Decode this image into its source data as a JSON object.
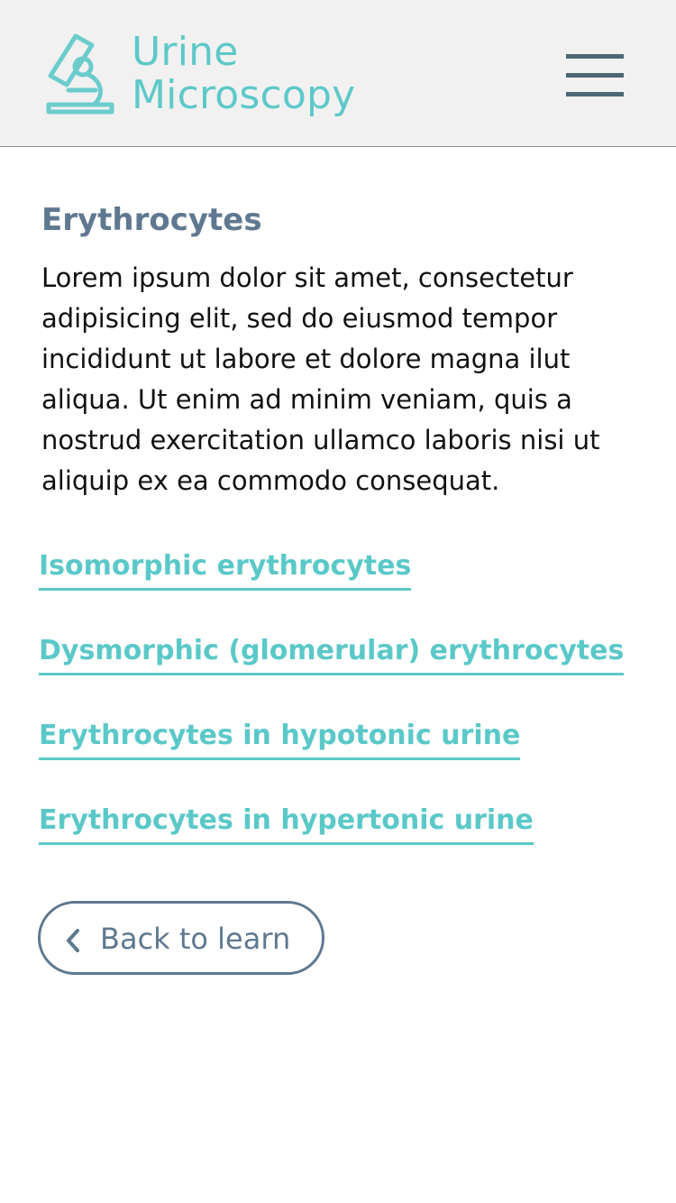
{
  "header": {
    "brand_line1": "Urine",
    "brand_line2": "Microscopy",
    "logo_icon": "microscope-icon",
    "menu_icon": "hamburger-menu-icon"
  },
  "main": {
    "title": "Erythrocytes",
    "description": "Lorem ipsum dolor sit amet, consectetur adipisicing elit, sed do eiusmod tempor incididunt ut labore et dolore magna ilut aliqua. Ut enim ad minim veniam, quis a nostrud exercitation ullamco laboris nisi ut aliquip ex ea commodo consequat.",
    "links": [
      "Isomorphic erythrocytes",
      "Dysmorphic (glomerular) erythrocytes",
      "Erythrocytes in hypotonic urine",
      "Erythrocytes in hypertonic urine"
    ],
    "back_button": {
      "label": "Back to learn",
      "icon": "chevron-left-icon"
    }
  },
  "colors": {
    "brand_teal": "#5ec8c8",
    "heading_slate": "#5f7890",
    "menu_dark": "#4c6873",
    "header_bg": "#f1f1f1"
  }
}
